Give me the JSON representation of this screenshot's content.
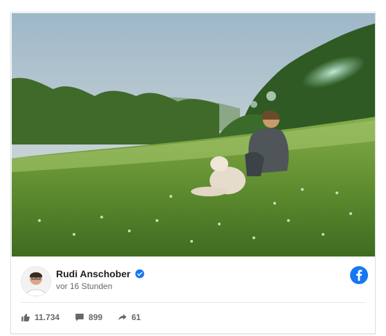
{
  "post": {
    "author": "Rudi Anschober",
    "time": "vor 16 Stunden",
    "likes": "11.734",
    "comments": "899",
    "shares": "61"
  },
  "icons": {
    "verified": "verified-badge-icon",
    "facebook": "facebook-icon",
    "like": "thumbs-up-icon",
    "comment": "comment-icon",
    "share": "share-arrow-icon"
  },
  "colors": {
    "facebook_blue": "#1877f2",
    "text_primary": "#1c1e21",
    "text_secondary": "#65676b"
  }
}
